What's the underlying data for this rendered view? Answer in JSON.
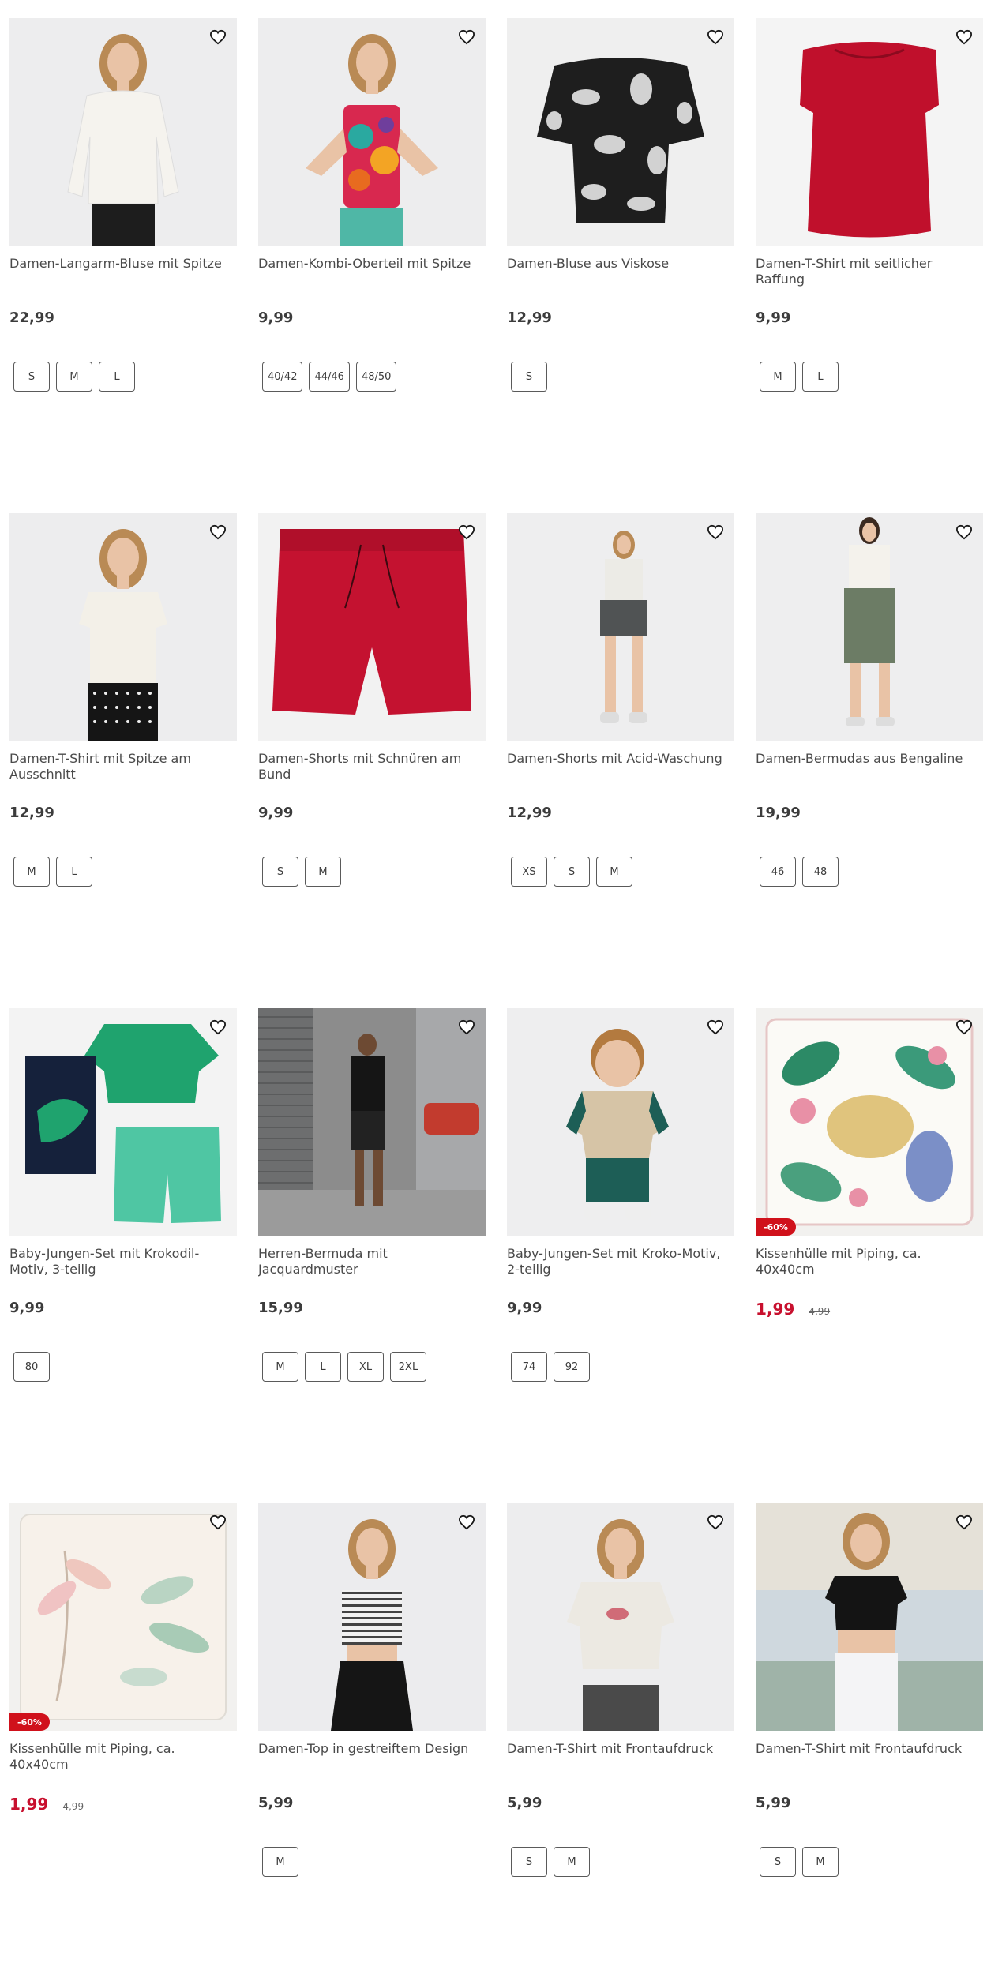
{
  "icons": {
    "wishlist": "heart-outline-icon"
  },
  "colors": {
    "sale_price": "#c8102e",
    "badge": "#d0111b",
    "text": "#3c3c3c"
  },
  "products": [
    {
      "title": "Damen-Langarm-Bluse mit Spitze",
      "price": "22,99",
      "sizes": [
        "S",
        "M",
        "L"
      ],
      "art": "blouse-white"
    },
    {
      "title": "Damen-Kombi-Oberteil mit Spitze",
      "price": "9,99",
      "sizes": [
        "40/42",
        "44/46",
        "48/50"
      ],
      "art": "top-floral"
    },
    {
      "title": "Damen-Bluse aus Viskose",
      "price": "12,99",
      "sizes": [
        "S"
      ],
      "art": "blouse-black"
    },
    {
      "title": "Damen-T-Shirt mit seitlicher Raffung",
      "price": "9,99",
      "sizes": [
        "M",
        "L"
      ],
      "art": "shirt-red"
    },
    {
      "title": "Damen-T-Shirt mit Spitze am Ausschnitt",
      "price": "12,99",
      "sizes": [
        "M",
        "L"
      ],
      "art": "tee-white-lace"
    },
    {
      "title": "Damen-Shorts mit Schnüren am Bund",
      "price": "9,99",
      "sizes": [
        "S",
        "M"
      ],
      "art": "shorts-red"
    },
    {
      "title": "Damen-Shorts mit Acid-Waschung",
      "price": "12,99",
      "sizes": [
        "XS",
        "S",
        "M"
      ],
      "art": "shorts-acid"
    },
    {
      "title": "Damen-Bermudas aus Bengaline",
      "price": "19,99",
      "sizes": [
        "46",
        "48"
      ],
      "art": "bermuda-green"
    },
    {
      "title": "Baby-Jungen-Set mit Krokodil-Motiv, 3-teilig",
      "price": "9,99",
      "sizes": [
        "80"
      ],
      "art": "baby-croco"
    },
    {
      "title": "Herren-Bermuda mit Jacquardmuster",
      "price": "15,99",
      "sizes": [
        "M",
        "L",
        "XL",
        "2XL"
      ],
      "art": "men-street"
    },
    {
      "title": "Baby-Jungen-Set mit Kroko-Motiv, 2-teilig",
      "price": "9,99",
      "sizes": [
        "74",
        "92"
      ],
      "art": "toddler"
    },
    {
      "title": "Kissenhülle mit Piping, ca. 40x40cm",
      "price": "1,99",
      "old_price": "4,99",
      "badge": "-60%",
      "sizes": [],
      "art": "pillow-leaves"
    },
    {
      "title": "Kissenhülle mit Piping, ca. 40x40cm",
      "price": "1,99",
      "old_price": "4,99",
      "badge": "-60%",
      "sizes": [],
      "art": "pillow-pastel"
    },
    {
      "title": "Damen-Top in gestreiftem Design",
      "price": "5,99",
      "sizes": [
        "M"
      ],
      "art": "top-stripe"
    },
    {
      "title": "Damen-T-Shirt mit Frontaufdruck",
      "price": "5,99",
      "sizes": [
        "S",
        "M"
      ],
      "art": "tee-print-white"
    },
    {
      "title": "Damen-T-Shirt mit Frontaufdruck",
      "price": "5,99",
      "sizes": [
        "S",
        "M"
      ],
      "art": "tee-print-black"
    }
  ]
}
